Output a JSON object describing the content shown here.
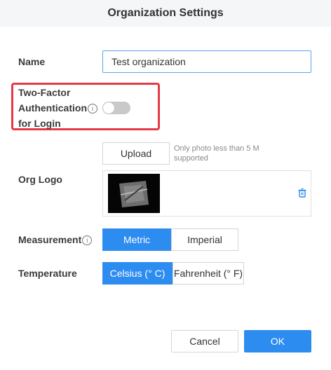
{
  "dialog": {
    "title": "Organization Settings"
  },
  "name_field": {
    "label": "Name",
    "value": "Test organization"
  },
  "two_factor": {
    "label_line1": "Two-Factor",
    "label_line2": "Authentication",
    "label_line3": "for Login",
    "info_glyph": "i",
    "enabled": false
  },
  "org_logo": {
    "label": "Org Logo",
    "upload_label": "Upload",
    "hint": "Only photo less than 5 M supported",
    "delete_icon": "trash-icon"
  },
  "measurement": {
    "label": "Measurement",
    "info_glyph": "i",
    "options": [
      "Metric",
      "Imperial"
    ],
    "selected": "Metric"
  },
  "temperature": {
    "label": "Temperature",
    "options": [
      "Celsius (° C)",
      "Fahrenheit (° F)"
    ],
    "selected": "Celsius (° C)"
  },
  "footer": {
    "cancel_label": "Cancel",
    "ok_label": "OK"
  },
  "colors": {
    "primary": "#2d8cf0",
    "highlight_border": "#e63946",
    "toggle_off": "#c9c9c9"
  }
}
